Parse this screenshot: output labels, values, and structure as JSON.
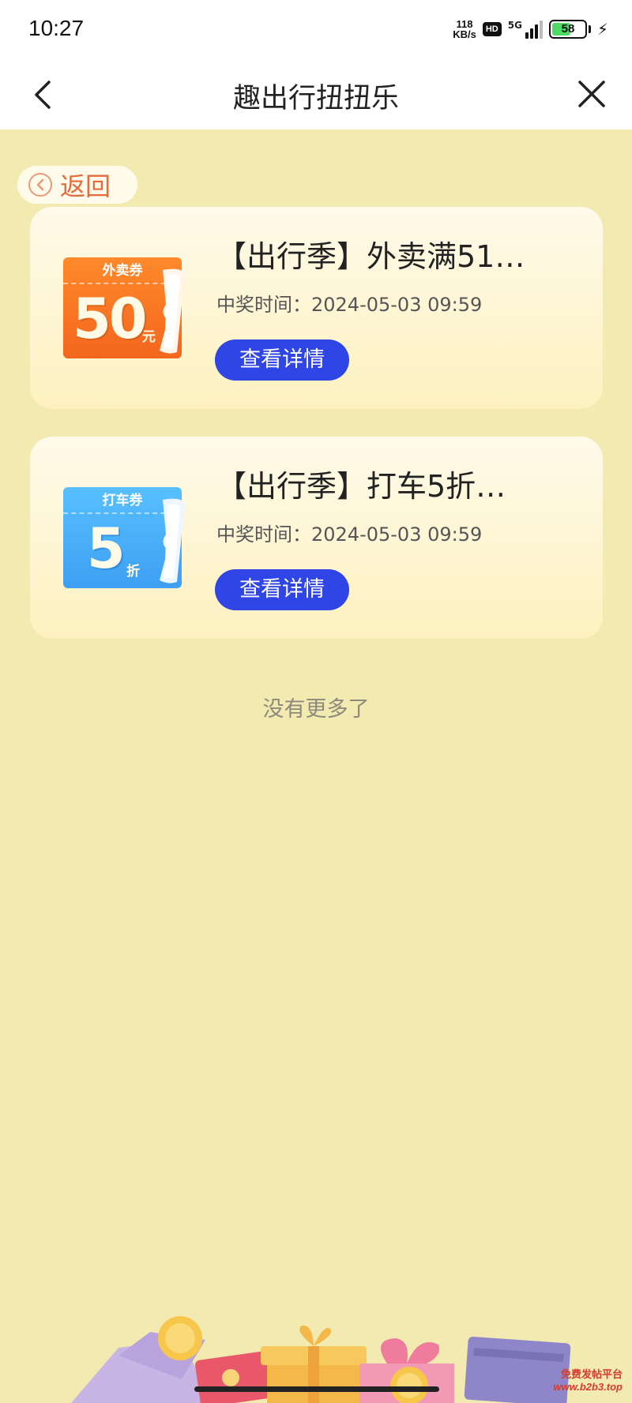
{
  "status_bar": {
    "time": "10:27",
    "net_speed_value": "118",
    "net_speed_unit": "KB/s",
    "hd_badge": "HD",
    "network": "5G",
    "battery_level": "58",
    "battery_fraction": 0.58
  },
  "nav": {
    "title": "趣出行扭扭乐"
  },
  "back_pill": {
    "label": "返回"
  },
  "prizes": [
    {
      "coupon_head": "外卖券",
      "coupon_value": "50",
      "coupon_unit": "元",
      "coupon_color": "#f4661e",
      "title": "【出行季】外卖满51…",
      "time": "中奖时间：2024-05-03 09:59",
      "button": "查看详情"
    },
    {
      "coupon_head": "打车券",
      "coupon_value": "5",
      "coupon_unit": "折",
      "coupon_color": "#3e9ff2",
      "title": "【出行季】打车5折…",
      "time": "中奖时间：2024-05-03 09:59",
      "button": "查看详情"
    }
  ],
  "footer": {
    "no_more": "没有更多了"
  },
  "watermark": {
    "line1": "免费发帖平台",
    "line2": "www.b2b3.top"
  },
  "colors": {
    "background": "#f2eab0",
    "button": "#2f45e6",
    "back_text": "#e56a3c"
  }
}
